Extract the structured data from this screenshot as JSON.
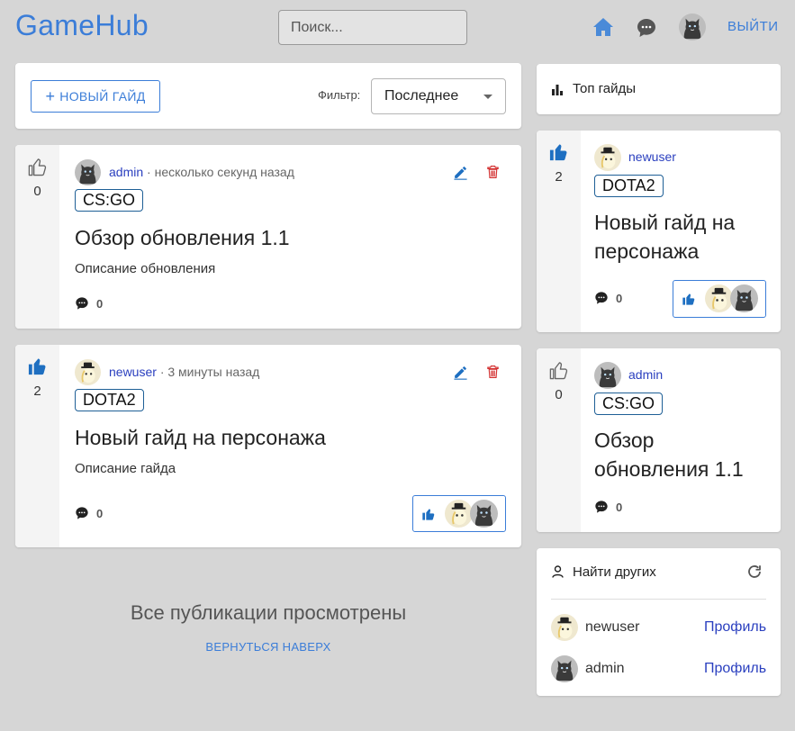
{
  "header": {
    "logo": "GameHub",
    "search_placeholder": "Поиск...",
    "logout_label": "ВЫЙТИ"
  },
  "toolbar": {
    "new_guide_label": "НОВЫЙ ГАЙД",
    "filter_label": "Фильтр:",
    "filter_selected": "Последнее"
  },
  "feed": [
    {
      "likes": "0",
      "author": "admin",
      "time": "· несколько секунд назад",
      "tag": "CS:GO",
      "title": "Обзор обновления 1.1",
      "description": "Описание обновления",
      "comments": "0"
    },
    {
      "likes": "2",
      "author": "newuser",
      "time": "· 3 минуты назад",
      "tag": "DOTA2",
      "title": "Новый гайд на персонажа",
      "description": "Описание гайда",
      "comments": "0"
    }
  ],
  "end_of_feed": {
    "message": "Все публикации просмотрены",
    "back_to_top": "ВЕРНУТЬСЯ НАВЕРХ"
  },
  "sidebar": {
    "top_title": "Топ гайды",
    "top": [
      {
        "likes": "2",
        "author": "newuser",
        "tag": "DOTA2",
        "title_line1": "Новый гайд на",
        "title_line2": "персонажа",
        "comments": "0"
      },
      {
        "likes": "0",
        "author": "admin",
        "tag": "CS:GO",
        "title_line1": "Обзор",
        "title_line2": "обновления 1.1",
        "comments": "0"
      }
    ],
    "find_title": "Найти других",
    "users": [
      {
        "name": "newuser",
        "link": "Профиль"
      },
      {
        "name": "admin",
        "link": "Профиль"
      }
    ]
  },
  "colors": {
    "accent": "#3b7dd8",
    "delete": "#d32f2f",
    "background": "#d6d6d6"
  }
}
